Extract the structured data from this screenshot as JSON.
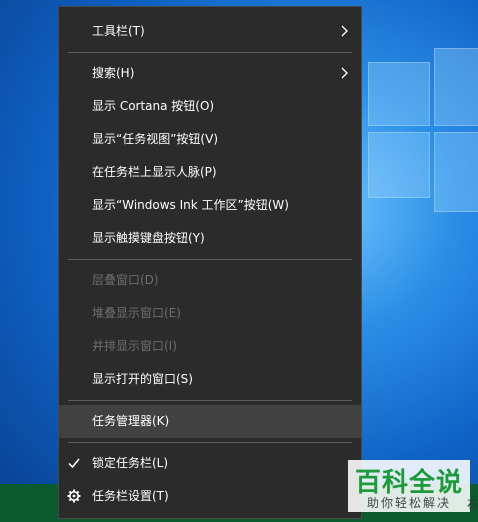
{
  "menu": {
    "items": [
      {
        "label": "工具栏(T)",
        "state": "normal",
        "submenu": true
      },
      {
        "label": "搜索(H)",
        "state": "normal",
        "submenu": true
      },
      {
        "label": "显示 Cortana 按钮(O)",
        "state": "normal"
      },
      {
        "label": "显示“任务视图”按钮(V)",
        "state": "normal"
      },
      {
        "label": "在任务栏上显示人脉(P)",
        "state": "normal"
      },
      {
        "label": "显示“Windows Ink 工作区”按钮(W)",
        "state": "normal"
      },
      {
        "label": "显示触摸键盘按钮(Y)",
        "state": "normal"
      },
      {
        "label": "层叠窗口(D)",
        "state": "disabled"
      },
      {
        "label": "堆叠显示窗口(E)",
        "state": "disabled"
      },
      {
        "label": "并排显示窗口(I)",
        "state": "disabled"
      },
      {
        "label": "显示打开的窗口(S)",
        "state": "normal"
      },
      {
        "label": "任务管理器(K)",
        "state": "highlighted"
      },
      {
        "label": "锁定任务栏(L)",
        "state": "checked",
        "icon": "check-icon"
      },
      {
        "label": "任务栏设置(T)",
        "state": "normal",
        "icon": "gear-icon"
      }
    ]
  },
  "watermark": {
    "title": "百科全说",
    "subtitle": "助你轻松解决",
    "edge_glyph": "石"
  },
  "colors": {
    "menu_bg": "#2b2b2b",
    "menu_text": "#ffffff",
    "disabled_text": "#6d6d6d",
    "highlight_bg": "#414141",
    "separator": "#5b5b5b",
    "watermark_green": "#1d9b3a"
  }
}
